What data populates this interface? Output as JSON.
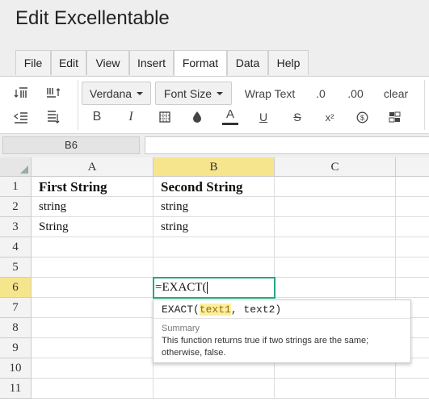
{
  "app": {
    "title": "Edit Excellentable"
  },
  "menu": {
    "tabs": [
      {
        "label": "File"
      },
      {
        "label": "Edit"
      },
      {
        "label": "View"
      },
      {
        "label": "Insert"
      },
      {
        "label": "Format",
        "active": true
      },
      {
        "label": "Data"
      },
      {
        "label": "Help"
      }
    ]
  },
  "toolbar": {
    "font_family": "Verdana",
    "font_size": "Font Size",
    "wrap_text": "Wrap Text",
    "decrease_decimals": ".0",
    "increase_decimals": ".00",
    "clear": "clear",
    "bold": "B",
    "italic": "I",
    "font_color": "A",
    "underline": "U",
    "strikethrough": "S",
    "superscript": "x²"
  },
  "formula_bar": {
    "cell_ref": "B6",
    "value": ""
  },
  "grid": {
    "columns": [
      "A",
      "B",
      "C"
    ],
    "selected_column": "B",
    "rows": [
      "1",
      "2",
      "3",
      "4",
      "5",
      "6",
      "7",
      "8",
      "9",
      "10",
      "11"
    ],
    "selected_row": "6",
    "cells": {
      "A1": "First String",
      "B1": "Second String",
      "A2": "string",
      "B2": "string",
      "A3": "String",
      "B3": "string"
    },
    "editing_cell": {
      "ref": "B6",
      "value": "=EXACT("
    }
  },
  "autocomplete": {
    "fn_name": "EXACT(",
    "param_active": "text1",
    "param_rest": ", text2)",
    "summary_label": "Summary",
    "description": "This function returns true if two strings are the same; otherwise, false."
  }
}
